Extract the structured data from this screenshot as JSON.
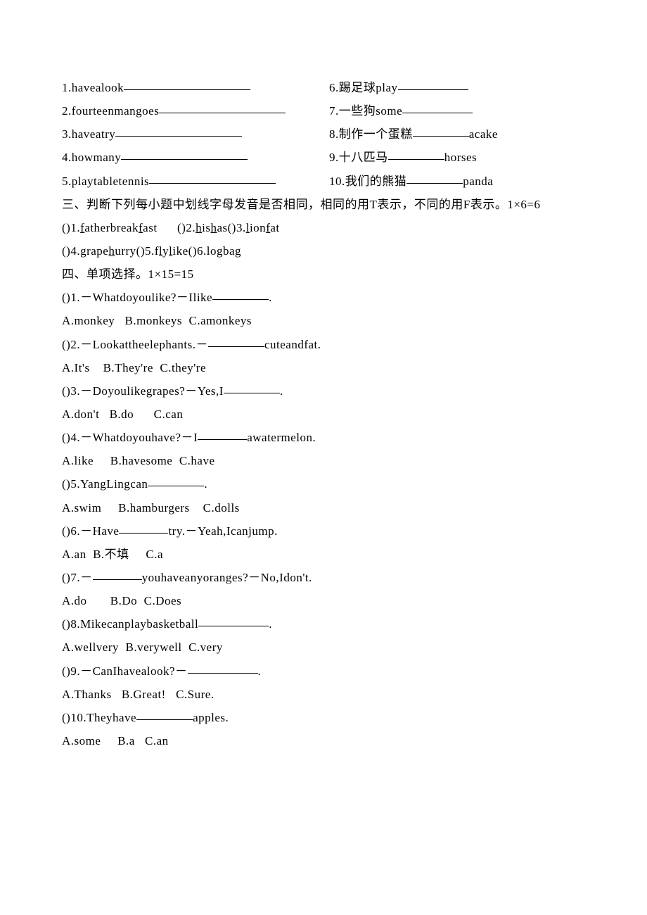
{
  "fill_left": [
    {
      "n": "1.",
      "t": "havealook"
    },
    {
      "n": "2.",
      "t": "fourteenmangoes"
    },
    {
      "n": "3.",
      "t": "haveatry"
    },
    {
      "n": "4.",
      "t": "howmany"
    },
    {
      "n": "5.",
      "t": "playtabletennis"
    }
  ],
  "fill_right": [
    {
      "n": "6.",
      "pre": "踢足球play",
      "post": ""
    },
    {
      "n": "7.",
      "pre": "一些狗some",
      "post": ""
    },
    {
      "n": "8.",
      "pre": "制作一个蛋糕",
      "post": "acake"
    },
    {
      "n": "9.",
      "pre": "十八匹马",
      "post": "horses"
    },
    {
      "n": "10.",
      "pre": "我们的熊猫",
      "post": "panda"
    }
  ],
  "sec3_title": "三、判断下列每小题中划线字母发音是否相同，相同的用T表示，不同的用F表示。1×6=6",
  "sec3_line1": {
    "p1a": "()1.",
    "w1a_pre": "f",
    "w1a_mid": "atherbreak",
    "w1a_u": "f",
    "w1a_post": "ast",
    "p2a": "()2.",
    "w2a_u1": "h",
    "w2a_mid": "is",
    "w2a_u2": "h",
    "w2a_post": "as",
    "p3a": "()3.",
    "w3a_u1": "l",
    "w3a_mid": "ion",
    "w3a_u2": "f",
    "w3a_post": "at"
  },
  "sec3_line2": {
    "p4": "()4.",
    "w4_pre": "grape",
    "w4_u1": "h",
    "w4_mid": "urry",
    "p5": "()5.",
    "w5_pre": "f",
    "w5_u1": "l",
    "w5_mid": "y",
    "w5_u2": "l",
    "w5_post": "ike",
    "p6": "()6.",
    "w6_pre": "lo",
    "w6_u1": "g",
    "w6_mid": "ba",
    "w6_u2": "g"
  },
  "sec4_title": "四、单项选择。1×15=15",
  "q": [
    {
      "n": "()1.",
      "q_pre": "－Whatdoyoulike?－Ilike",
      "q_post": ".",
      "a": "A.monkey   B.monkeys  C.amonkeys"
    },
    {
      "n": "()2.",
      "q_pre": "－Lookattheelephants.－",
      "q_post": "cuteandfat.",
      "a": "A.It's    B.They're  C.they're"
    },
    {
      "n": "()3.",
      "q_pre": "－Doyoulikegrapes?－Yes,I",
      "q_post": ".",
      "a": "A.don't   B.do      C.can"
    },
    {
      "n": "()4.",
      "q_pre": "－Whatdoyouhave?－I",
      "q_post": "awatermelon.",
      "a": "A.like     B.havesome  C.have"
    },
    {
      "n": "()5.",
      "q_pre": "YangLingcan",
      "q_post": ".",
      "a": "A.swim     B.hamburgers    C.dolls"
    },
    {
      "n": "()6.",
      "q_pre": "－Have",
      "q_post": "try.－Yeah,Icanjump.",
      "a": "A.an  B.不填     C.a"
    },
    {
      "n": "()7.",
      "q_pre": "－",
      "q_post": "youhaveanyoranges?－No,Idon't.",
      "a": "A.do       B.Do  C.Does"
    },
    {
      "n": "()8.",
      "q_pre": "Mikecanplaybasketball",
      "q_post": ".",
      "a": "A.wellvery  B.verywell  C.very"
    },
    {
      "n": "()9.",
      "q_pre": "－CanIhavealook?－",
      "q_post": ".",
      "a": "A.Thanks   B.Great!   C.Sure."
    },
    {
      "n": "()10.",
      "q_pre": "Theyhave",
      "q_post": "apples.",
      "a": "A.some     B.a   C.an"
    }
  ]
}
